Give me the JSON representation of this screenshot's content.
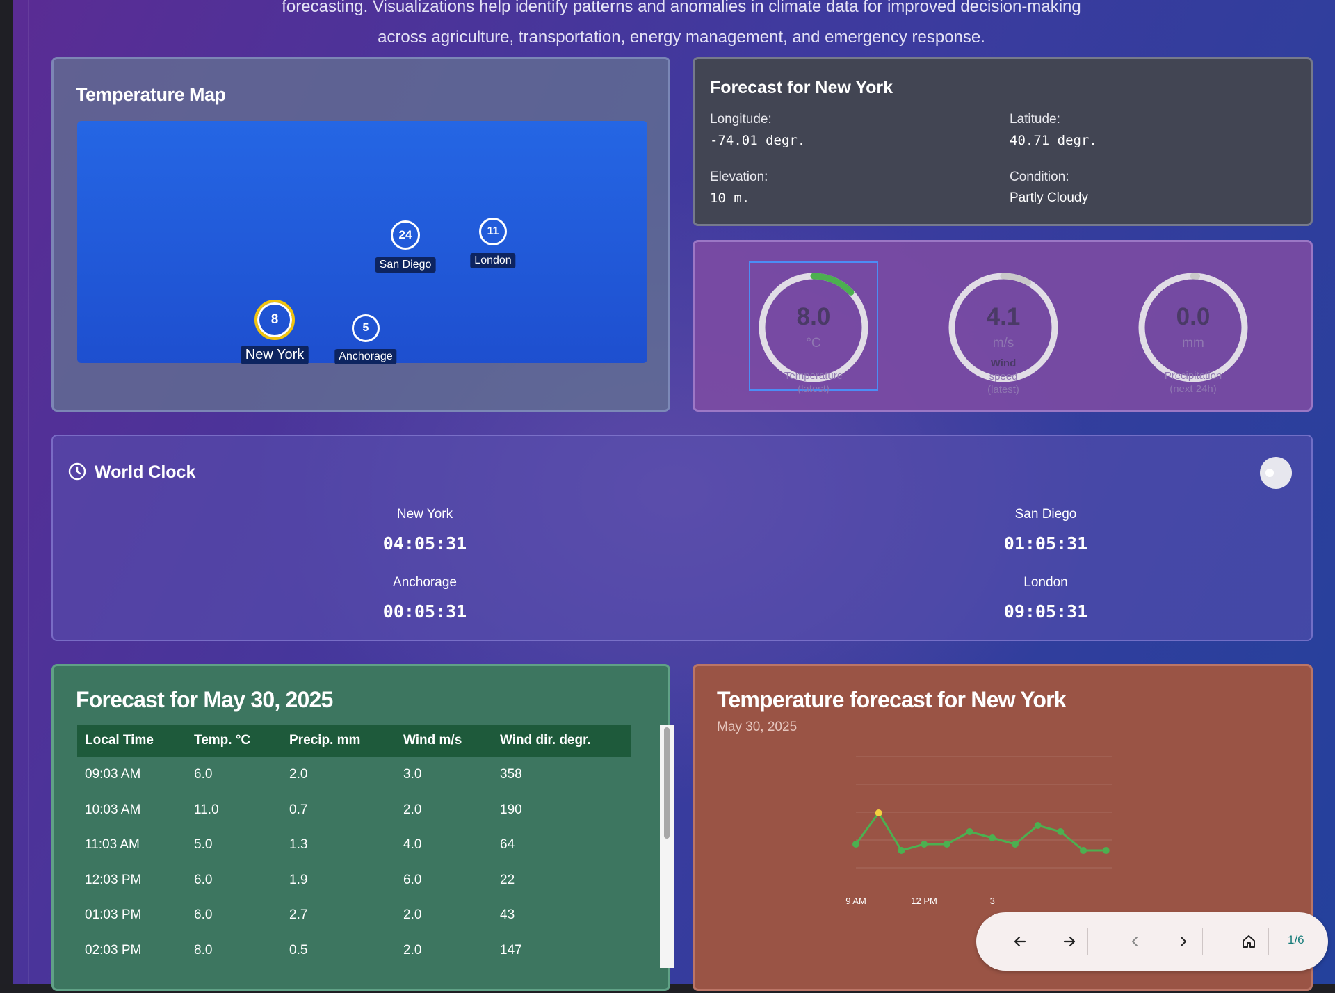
{
  "intro": {
    "line1": "forecasting. Visualizations help identify patterns and anomalies in climate data for improved decision-making",
    "line2": "across agriculture, transportation, energy management, and emergency response."
  },
  "map": {
    "title": "Temperature Map",
    "markers": [
      {
        "city": "San Diego",
        "temp": "24",
        "color": "#e8743b"
      },
      {
        "city": "London",
        "temp": "11",
        "color": "#d8b40c"
      },
      {
        "city": "New York",
        "temp": "8",
        "color": "#4caf50",
        "selected": true
      },
      {
        "city": "Anchorage",
        "temp": "5",
        "color": "#4caf50"
      }
    ]
  },
  "info": {
    "title": "Forecast for New York",
    "longitude_label": "Longitude:",
    "longitude_value": "-74.01 degr.",
    "latitude_label": "Latitude:",
    "latitude_value": "40.71 degr.",
    "elevation_label": "Elevation:",
    "elevation_value": "10 m.",
    "condition_label": "Condition:",
    "condition_value": "Partly Cloudy"
  },
  "gauges": [
    {
      "value": "8.0",
      "unit": "°C",
      "caption": [
        "Temperature",
        "(latest)"
      ],
      "fraction": 0.13,
      "arc_color": "#4caf50"
    },
    {
      "value": "4.1",
      "unit": "m/s",
      "caption": [
        "Wind",
        "speed",
        "(latest)"
      ],
      "fraction": 0.08,
      "arc_color": "#c9c9c9"
    },
    {
      "value": "0.0",
      "unit": "mm",
      "caption": [
        "Precipitation",
        "(next 24h)"
      ],
      "fraction": 0.0,
      "arc_color": "#c9c9c9"
    }
  ],
  "clock": {
    "title": "World Clock",
    "cities": [
      {
        "name": "New York",
        "time": "04:05:31"
      },
      {
        "name": "San Diego",
        "time": "01:05:31"
      },
      {
        "name": "Anchorage",
        "time": "00:05:31"
      },
      {
        "name": "London",
        "time": "09:05:31"
      }
    ]
  },
  "forecast_table": {
    "title": "Forecast for May 30, 2025",
    "columns": [
      "Local Time",
      "Temp. °C",
      "Precip. mm",
      "Wind m/s",
      "Wind dir. degr."
    ],
    "rows": [
      [
        "09:03 AM",
        "6.0",
        "2.0",
        "3.0",
        "358"
      ],
      [
        "10:03 AM",
        "11.0",
        "0.7",
        "2.0",
        "190"
      ],
      [
        "11:03 AM",
        "5.0",
        "1.3",
        "4.0",
        "64"
      ],
      [
        "12:03 PM",
        "6.0",
        "1.9",
        "6.0",
        "22"
      ],
      [
        "01:03 PM",
        "6.0",
        "2.7",
        "2.0",
        "43"
      ],
      [
        "02:03 PM",
        "8.0",
        "0.5",
        "2.0",
        "147"
      ]
    ]
  },
  "chart": {
    "title": "Temperature forecast for New York",
    "subtitle": "May 30, 2025"
  },
  "chart_data": {
    "type": "line",
    "x_tick_labels": [
      "9 AM",
      "12 PM",
      "3"
    ],
    "series": [
      {
        "values": [
          6,
          11,
          5,
          6,
          6,
          8,
          7,
          6,
          9,
          8,
          5,
          5
        ],
        "highlight_index": 1
      }
    ],
    "highlight_color": "#f4d03f",
    "line_color": "#4cb050",
    "grid": true
  },
  "nav": {
    "page_indicator": "1/6"
  }
}
